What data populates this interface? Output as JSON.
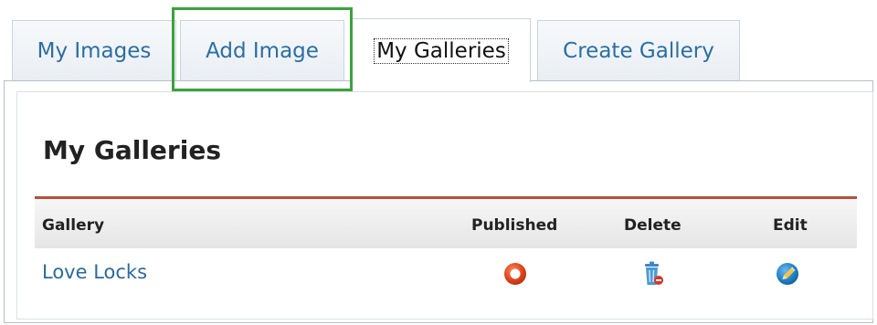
{
  "tabs": [
    {
      "label": "My Images",
      "active": false
    },
    {
      "label": "Add Image",
      "active": false,
      "highlighted": true
    },
    {
      "label": "My Galleries",
      "active": true
    },
    {
      "label": "Create Gallery",
      "active": false
    }
  ],
  "page": {
    "title": "My Galleries"
  },
  "table": {
    "columns": [
      "Gallery",
      "Published",
      "Delete",
      "Edit"
    ],
    "rows": [
      {
        "gallery": "Love Locks",
        "published_icon": "published-status-icon",
        "delete_icon": "trash-icon",
        "edit_icon": "pencil-icon"
      }
    ]
  },
  "colors": {
    "tab_text": "#2b6ea3",
    "highlight": "#3aa33a",
    "rule": "#b4503a",
    "link": "#2a6a9f",
    "published_icon": "#e0451f",
    "edit_icon": "#1f7fc6"
  }
}
